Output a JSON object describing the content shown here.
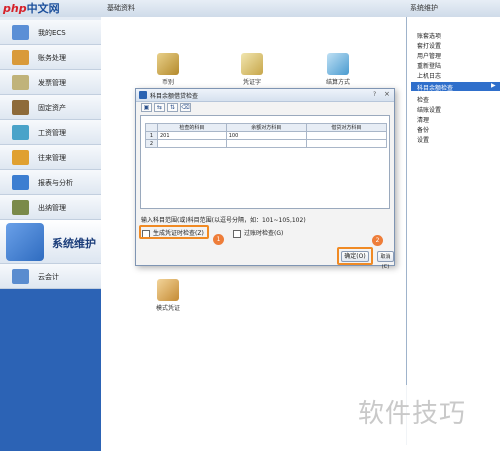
{
  "logo": {
    "brand": "php",
    "site": "中文网"
  },
  "top_sections": {
    "main": "基础资料",
    "right": "系统维护"
  },
  "sidebar": {
    "items": [
      {
        "label": "我的ECS",
        "icon": "monitor-icon",
        "color": "#5b8fd6"
      },
      {
        "label": "账务处理",
        "icon": "ledger-icon",
        "color": "#d99a3a"
      },
      {
        "label": "发票管理",
        "icon": "invoice-icon",
        "color": "#c0b37a"
      },
      {
        "label": "固定资产",
        "icon": "asset-icon",
        "color": "#8e6b3a"
      },
      {
        "label": "工资管理",
        "icon": "payroll-icon",
        "color": "#4aa3c9"
      },
      {
        "label": "往来管理",
        "icon": "contacts-icon",
        "color": "#e0a030"
      },
      {
        "label": "报表与分析",
        "icon": "report-icon",
        "color": "#3c7ed1"
      },
      {
        "label": "出纳管理",
        "icon": "cashier-icon",
        "color": "#7a8a4a"
      },
      {
        "label": "系统维护",
        "icon": "system-maintenance-icon",
        "color": "#2f6cc0"
      },
      {
        "label": "云会计",
        "icon": "cloud-accounting-icon",
        "color": "#5a8ccf"
      }
    ]
  },
  "main": {
    "icons": [
      {
        "label": "币别",
        "icon": "currency-icon"
      },
      {
        "label": "凭证字",
        "icon": "voucher-type-icon"
      },
      {
        "label": "结算方式",
        "icon": "settlement-icon"
      },
      {
        "label": "模式凭证",
        "icon": "template-voucher-icon"
      }
    ]
  },
  "right_panel": {
    "items": [
      "账套选项",
      "套打设置",
      "用户管理",
      "重新登陆",
      "上机日志",
      "科目余额检查",
      "检查",
      "结账设置",
      "清理",
      "备份",
      "设置"
    ],
    "highlighted_index": 5
  },
  "dialog": {
    "title": "科目余额借贷检查",
    "help": "?",
    "close": "×",
    "toolbar": [
      "▣",
      "⇆",
      "⇅",
      "⌫"
    ],
    "table": {
      "headers": [
        "",
        "检查的科目",
        "余额对方科目",
        "借贷对方科目"
      ],
      "rows": [
        [
          "1",
          "201",
          "100",
          ""
        ],
        [
          "2",
          "",
          "",
          ""
        ]
      ]
    },
    "hint": "输入科目范围(或)科目范围(以逗号分隔，如：101~105,102)",
    "checkbox1": "生成凭证时检查(Z)",
    "checkbox2": "过账时检查(G)",
    "badge1": "1",
    "badge2": "2",
    "ok_button": "确定(O)",
    "cancel_button": "取消(C)"
  },
  "watermark": "软件技巧",
  "colors": {
    "accent_orange": "#f08a24",
    "sidebar_blue": "#2c63b5",
    "selection": "#2f6fcb"
  }
}
